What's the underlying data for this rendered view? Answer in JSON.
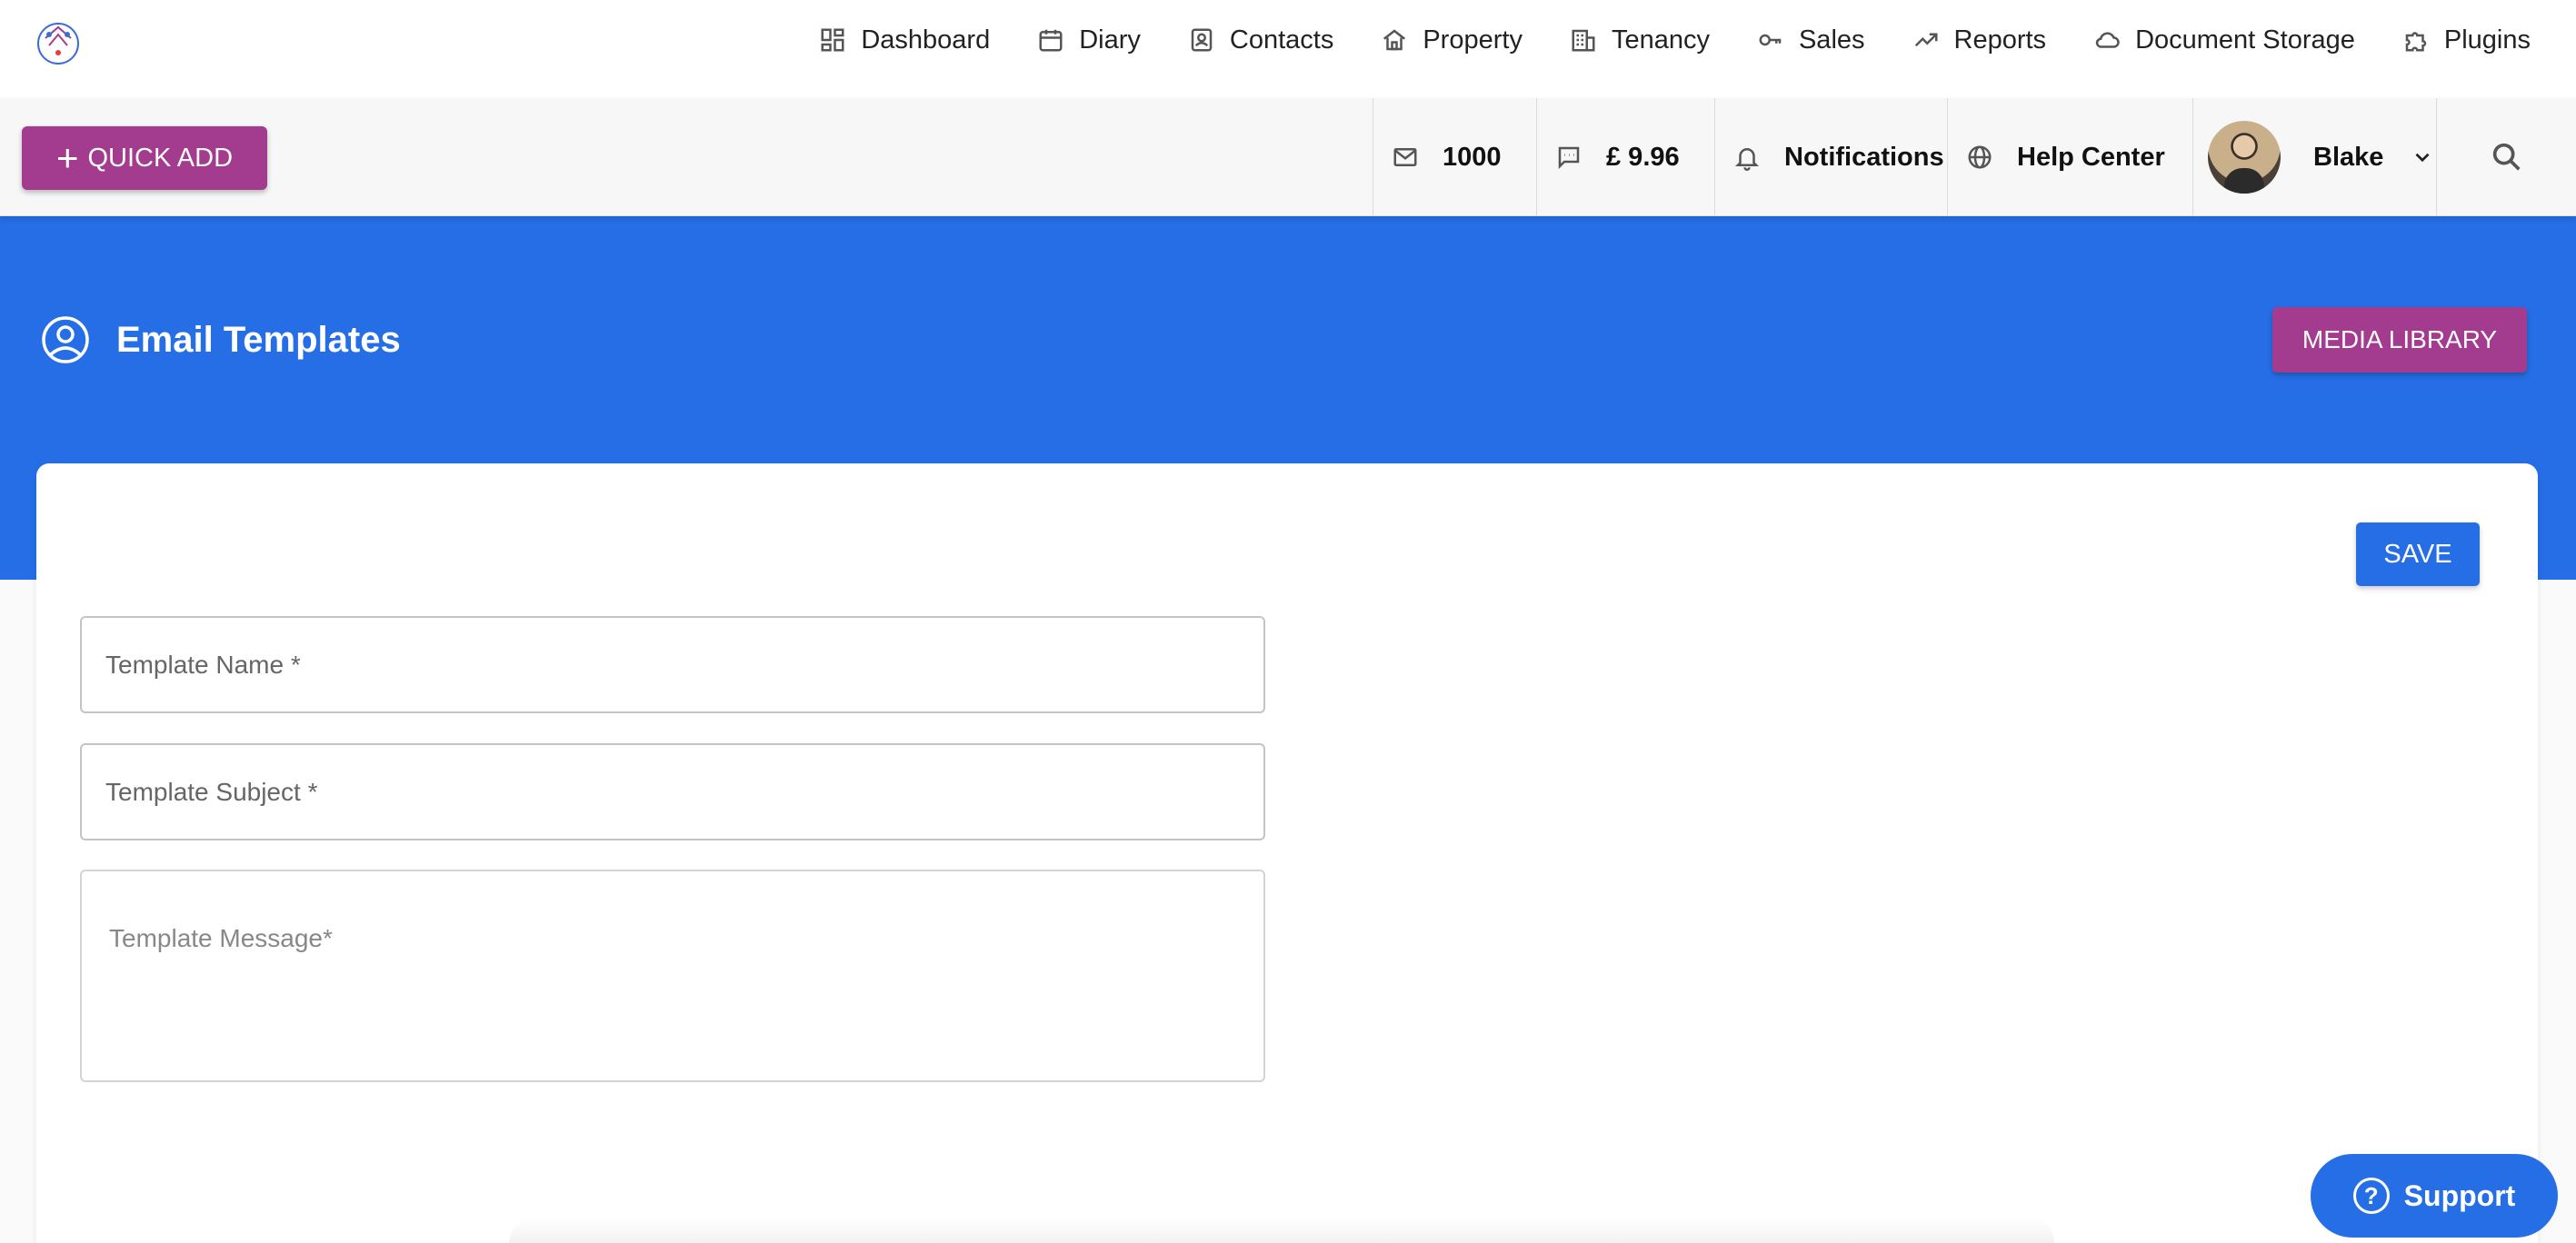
{
  "nav": {
    "items": [
      {
        "label": "Dashboard",
        "icon": "dashboard-icon"
      },
      {
        "label": "Diary",
        "icon": "calendar-icon"
      },
      {
        "label": "Contacts",
        "icon": "contacts-icon"
      },
      {
        "label": "Property",
        "icon": "home-icon"
      },
      {
        "label": "Tenancy",
        "icon": "building-icon"
      },
      {
        "label": "Sales",
        "icon": "key-icon"
      },
      {
        "label": "Reports",
        "icon": "trending-up-icon"
      },
      {
        "label": "Document Storage",
        "icon": "cloud-icon"
      },
      {
        "label": "Plugins",
        "icon": "puzzle-icon"
      }
    ]
  },
  "toolbar": {
    "quick_add_label": "QUICK ADD",
    "email_count": "1000",
    "sms_balance": "£ 9.96",
    "notifications_label": "Notifications",
    "help_label": "Help Center",
    "user_name": "Blake"
  },
  "header": {
    "title": "Email Templates",
    "media_library_label": "MEDIA LIBRARY"
  },
  "form": {
    "save_label": "SAVE",
    "template_name_placeholder": "Template Name *",
    "template_subject_placeholder": "Template Subject *",
    "template_message_placeholder": "Template Message*"
  },
  "support": {
    "label": "Support"
  },
  "colors": {
    "primary_blue": "#266ee6",
    "accent_magenta": "#a33b8f"
  }
}
